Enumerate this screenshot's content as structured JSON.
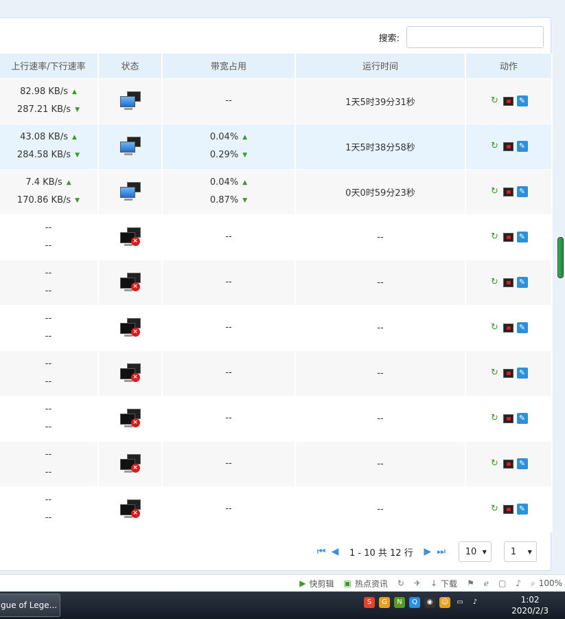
{
  "search": {
    "label": "搜索:",
    "value": "",
    "placeholder": ""
  },
  "table": {
    "headers": [
      "上行速率/下行速率",
      "状态",
      "带宽占用",
      "运行时间",
      "动作"
    ],
    "rows": [
      {
        "up": "82.98 KB/s",
        "down": "287.21 KB/s",
        "status": "online",
        "bw_up": "--",
        "bw_down": "",
        "uptime": "1天5时39分31秒"
      },
      {
        "up": "43.08 KB/s",
        "down": "284.58 KB/s",
        "status": "online",
        "bw_up": "0.04%",
        "bw_down": "0.29%",
        "uptime": "1天5时38分58秒"
      },
      {
        "up": "7.4 KB/s",
        "down": "170.86 KB/s",
        "status": "online",
        "bw_up": "0.04%",
        "bw_down": "0.87%",
        "uptime": "0天0时59分23秒"
      },
      {
        "up": "--",
        "down": "--",
        "status": "offline",
        "bw_up": "--",
        "bw_down": "",
        "uptime": "--"
      },
      {
        "up": "--",
        "down": "--",
        "status": "offline",
        "bw_up": "--",
        "bw_down": "",
        "uptime": "--"
      },
      {
        "up": "--",
        "down": "--",
        "status": "offline",
        "bw_up": "--",
        "bw_down": "",
        "uptime": "--"
      },
      {
        "up": "--",
        "down": "--",
        "status": "offline",
        "bw_up": "--",
        "bw_down": "",
        "uptime": "--"
      },
      {
        "up": "--",
        "down": "--",
        "status": "offline",
        "bw_up": "--",
        "bw_down": "",
        "uptime": "--"
      },
      {
        "up": "--",
        "down": "--",
        "status": "offline",
        "bw_up": "--",
        "bw_down": "",
        "uptime": "--"
      },
      {
        "up": "--",
        "down": "--",
        "status": "offline",
        "bw_up": "--",
        "bw_down": "",
        "uptime": "--"
      }
    ]
  },
  "pager": {
    "range": "1 - 10 共 12 行",
    "page_size": "10",
    "page": "1"
  },
  "statusbar": {
    "clip": "快剪辑",
    "news": "热点资讯",
    "download": "下载",
    "zoom": "100%"
  },
  "taskbar": {
    "task": "gue of Lege...",
    "time": "1:02",
    "date": "2020/2/3"
  },
  "colors": {
    "accent": "#3a8fe0",
    "header_bg": "#e4f0fa",
    "highlight_row": "#e7f4fd",
    "up_arrow": "#3a9a24",
    "offline_badge": "#d91c1c"
  }
}
